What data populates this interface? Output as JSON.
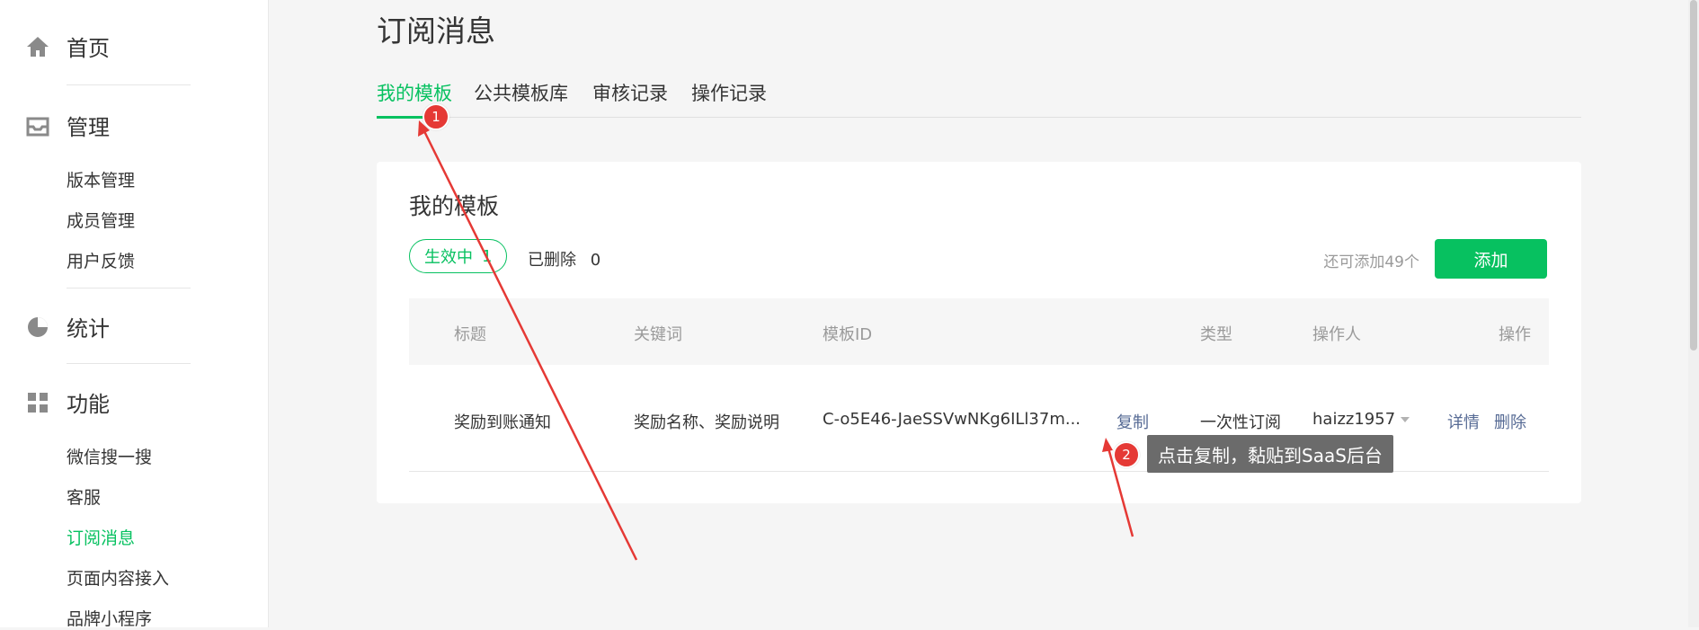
{
  "sidebar": {
    "home": "首页",
    "manage": "管理",
    "manage_items": [
      "版本管理",
      "成员管理",
      "用户反馈"
    ],
    "stats": "统计",
    "features": "功能",
    "feature_items": [
      "微信搜一搜",
      "客服",
      "订阅消息",
      "页面内容接入",
      "品牌小程序"
    ],
    "active_item": "订阅消息"
  },
  "page": {
    "title": "订阅消息",
    "tabs": [
      "我的模板",
      "公共模板库",
      "审核记录",
      "操作记录"
    ],
    "active_tab": "我的模板"
  },
  "card": {
    "title": "我的模板",
    "active_label": "生效中",
    "active_count": "1",
    "deleted_label": "已删除",
    "deleted_count": "0",
    "remain_text": "还可添加49个",
    "add_button": "添加"
  },
  "table": {
    "headers": [
      "标题",
      "关键词",
      "模板ID",
      "类型",
      "操作人",
      "操作"
    ],
    "rows": [
      {
        "title": "奖励到账通知",
        "keywords": "奖励名称、奖励说明",
        "template_id": "C-o5E46-JaeSSVwNKg6ILl37m...",
        "copy": "复制",
        "type": "一次性订阅",
        "operator": "haizz1957",
        "detail": "详情",
        "delete": "删除"
      }
    ]
  },
  "annotations": {
    "badge1": "1",
    "badge2": "2",
    "tooltip": "点击复制，黏贴到SaaS后台",
    "color": "#e53935"
  },
  "colors": {
    "accent": "#07c160",
    "link": "#576b95"
  }
}
